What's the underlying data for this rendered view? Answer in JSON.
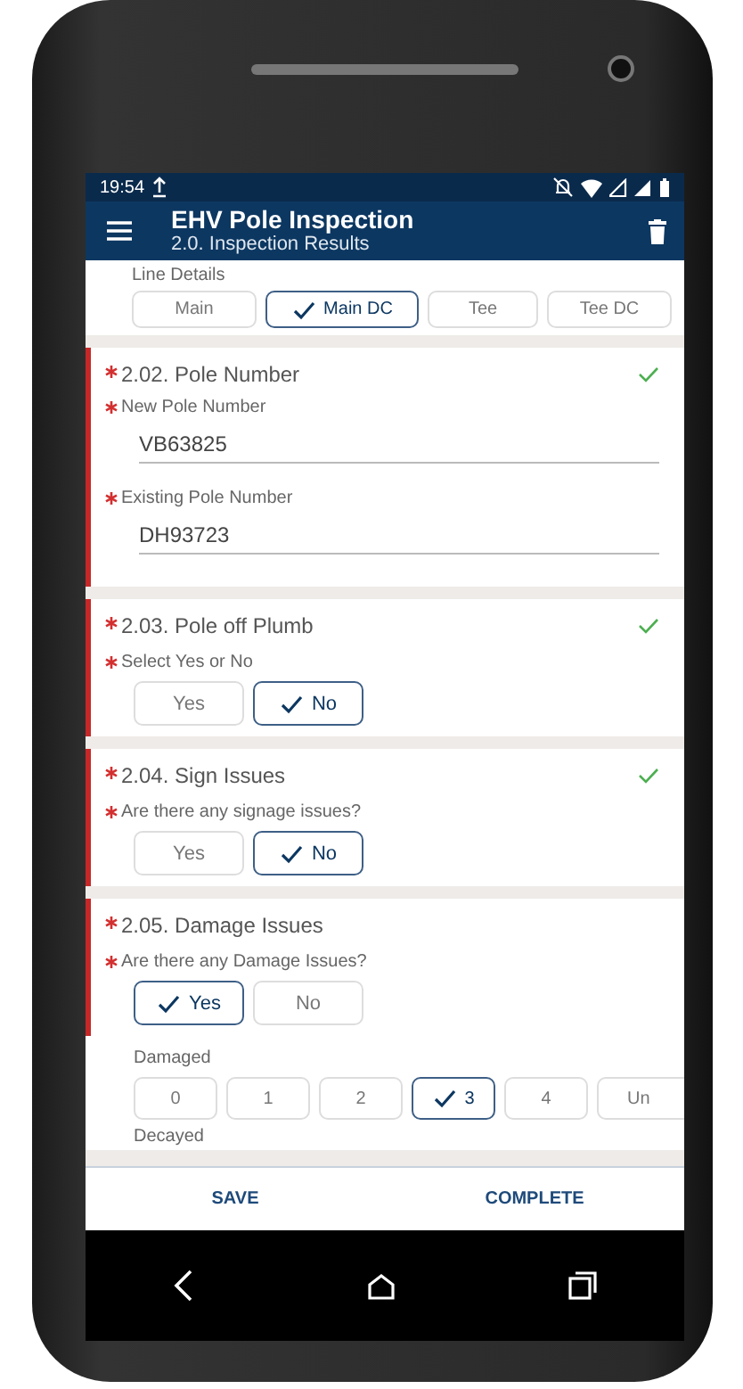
{
  "status_bar": {
    "time": "19:54"
  },
  "app_bar": {
    "title": "EHV Pole Inspection",
    "subtitle": "2.0. Inspection Results"
  },
  "line_details": {
    "label": "Line Details",
    "options": [
      {
        "label": "Main",
        "selected": false
      },
      {
        "label": "Main DC",
        "selected": true
      },
      {
        "label": "Tee",
        "selected": false
      },
      {
        "label": "Tee DC",
        "selected": false
      }
    ]
  },
  "sections": [
    {
      "title": "2.02. Pole Number",
      "required": true,
      "complete": true,
      "fields": [
        {
          "kind": "text",
          "label": "New Pole Number",
          "required": true,
          "value": "VB63825"
        },
        {
          "kind": "text",
          "label": "Existing Pole Number",
          "required": true,
          "value": "DH93723"
        }
      ]
    },
    {
      "title": "2.03. Pole off Plumb",
      "required": true,
      "complete": true,
      "fields": [
        {
          "kind": "choice",
          "label": "Select Yes or No",
          "required": true,
          "options": [
            {
              "label": "Yes",
              "selected": false
            },
            {
              "label": "No",
              "selected": true
            }
          ]
        }
      ]
    },
    {
      "title": "2.04. Sign Issues",
      "required": true,
      "complete": true,
      "fields": [
        {
          "kind": "choice",
          "label": "Are there any signage issues?",
          "required": true,
          "options": [
            {
              "label": "Yes",
              "selected": false
            },
            {
              "label": "No",
              "selected": true
            }
          ]
        }
      ]
    },
    {
      "title": "2.05. Damage Issues",
      "required": true,
      "complete": false,
      "fields": [
        {
          "kind": "choice",
          "label": "Are there any Damage Issues?",
          "required": true,
          "options": [
            {
              "label": "Yes",
              "selected": true
            },
            {
              "label": "No",
              "selected": false
            }
          ]
        }
      ],
      "sub_fields": [
        {
          "kind": "scale",
          "label": "Damaged",
          "required": false,
          "options": [
            {
              "label": "0",
              "selected": false
            },
            {
              "label": "1",
              "selected": false
            },
            {
              "label": "2",
              "selected": false
            },
            {
              "label": "3",
              "selected": true
            },
            {
              "label": "4",
              "selected": false
            },
            {
              "label": "Un",
              "selected": false
            }
          ]
        },
        {
          "kind": "heading",
          "label": "Decayed",
          "required": false
        }
      ]
    }
  ],
  "footer": {
    "buttons": [
      "SAVE",
      "COMPLETE"
    ]
  }
}
